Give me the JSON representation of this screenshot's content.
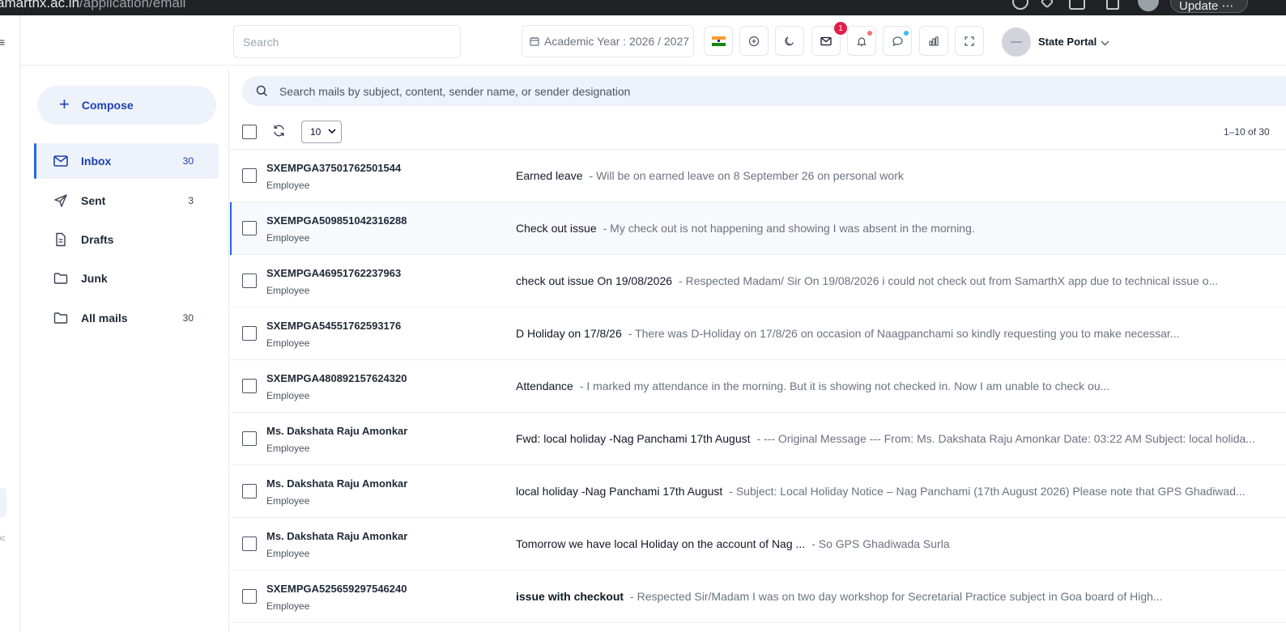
{
  "browser": {
    "url_host": "amarthx.ac.in",
    "url_path": "/application/email",
    "update_label": "Update"
  },
  "topbar": {
    "search_placeholder": "Search",
    "academic_year": "Academic Year : 2026 / 2027",
    "mail_badge": "1",
    "profile_name": "State Portal",
    "flag_colors": [
      "#ff9933",
      "#ffffff",
      "#138808"
    ]
  },
  "sidebar": {
    "compose_label": "Compose",
    "items": [
      {
        "label": "Inbox",
        "count": "30",
        "icon": "mail-icon"
      },
      {
        "label": "Sent",
        "count": "3",
        "icon": "send-icon"
      },
      {
        "label": "Drafts",
        "count": "",
        "icon": "document-icon"
      },
      {
        "label": "Junk",
        "count": "",
        "icon": "folder-icon"
      },
      {
        "label": "All mails",
        "count": "30",
        "icon": "folder-icon"
      }
    ]
  },
  "mail": {
    "search_placeholder": "Search mails by subject, content, sender name, or sender designation",
    "page_size": "10",
    "page_info": "1–10 of 30",
    "rows": [
      {
        "sender": "SXEMPGA37501762501544",
        "role": "Employee",
        "subject": "Earned leave",
        "preview": "- Will be on earned leave on 8 September 26 on personal work"
      },
      {
        "sender": "SXEMPGA509851042316288",
        "role": "Employee",
        "subject": "Check out issue",
        "preview": "- My check out is not happening and showing I was absent in the morning."
      },
      {
        "sender": "SXEMPGA46951762237963",
        "role": "Employee",
        "subject": "check out issue On 19/08/2026",
        "preview": "- Respected Madam/ Sir On 19/08/2026 i could not check out from SamarthX app due to technical issue o..."
      },
      {
        "sender": "SXEMPGA54551762593176",
        "role": "Employee",
        "subject": "D Holiday on 17/8/26",
        "preview": "- There was D-Holiday on 17/8/26 on occasion of Naagpanchami so kindly requesting you to make necessar..."
      },
      {
        "sender": "SXEMPGA480892157624320",
        "role": "Employee",
        "subject": "Attendance",
        "preview": "- I marked my attendance in the morning. But it is showing not checked in. Now I am unable to check ou..."
      },
      {
        "sender": "Ms. Dakshata Raju Amonkar",
        "role": "Employee",
        "subject": "Fwd: local holiday -Nag Panchami 17th August",
        "preview": "- --- Original Message --- From: Ms. Dakshata Raju Amonkar Date: 03:22 AM Subject: local holida..."
      },
      {
        "sender": "Ms. Dakshata Raju Amonkar",
        "role": "Employee",
        "subject": "local holiday -Nag Panchami 17th August",
        "preview": "- Subject: Local Holiday Notice – Nag Panchami (17th August 2026) Please note that GPS Ghadiwad..."
      },
      {
        "sender": "Ms. Dakshata Raju Amonkar",
        "role": "Employee",
        "subject": "Tomorrow we have local Holiday on the account of Nag ...",
        "preview": "- So GPS Ghadiwada Surla"
      },
      {
        "sender": "SXEMPGA525659297546240",
        "role": "Employee",
        "subject": "issue with checkout",
        "preview": "- Respected Sir/Madam I was on two day workshop for Secretarial Practice subject in Goa board of High..."
      }
    ]
  }
}
